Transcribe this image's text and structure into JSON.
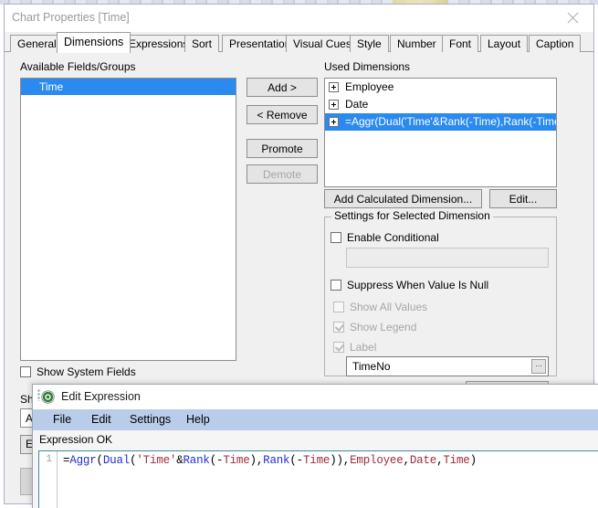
{
  "chart_properties": {
    "title": "Chart Properties [Time]",
    "close_icon": "close-icon",
    "tabs": [
      {
        "label": "General",
        "active": false
      },
      {
        "label": "Dimensions",
        "active": true
      },
      {
        "label": "Expressions",
        "active": false
      },
      {
        "label": "Sort",
        "active": false
      },
      {
        "label": "Presentation",
        "active": false
      },
      {
        "label": "Visual Cues",
        "active": false
      },
      {
        "label": "Style",
        "active": false
      },
      {
        "label": "Number",
        "active": false
      },
      {
        "label": "Font",
        "active": false
      },
      {
        "label": "Layout",
        "active": false
      },
      {
        "label": "Caption",
        "active": false
      }
    ],
    "available": {
      "label": "Available Fields/Groups",
      "items": [
        {
          "label": "Time",
          "selected": true
        }
      ]
    },
    "transfer_buttons": [
      {
        "label": "Add >",
        "enabled": true
      },
      {
        "label": "< Remove",
        "enabled": true
      },
      {
        "label": "Promote",
        "enabled": true
      },
      {
        "label": "Demote",
        "enabled": false
      }
    ],
    "used": {
      "label": "Used Dimensions",
      "items": [
        {
          "label": "Employee",
          "selected": false
        },
        {
          "label": "Date",
          "selected": false
        },
        {
          "label": "=Aggr(Dual('Time'&Rank(-Time),Rank(-Time)),Empl",
          "selected": true
        }
      ]
    },
    "add_calculated_label": "Add Calculated Dimension...",
    "edit_label": "Edit...",
    "settings": {
      "legend": "Settings for Selected Dimension",
      "enable_conditional": {
        "label": "Enable Conditional",
        "checked": false,
        "enabled": true
      },
      "conditional_value": "",
      "suppress_when_null": {
        "label": "Suppress When Value Is Null",
        "checked": false,
        "enabled": true
      },
      "show_all_values": {
        "label": "Show All Values",
        "checked": false,
        "enabled": false
      },
      "show_legend": {
        "label": "Show Legend",
        "checked": true,
        "enabled": false
      },
      "label_checkbox": {
        "label": "Label",
        "checked": true,
        "enabled": false
      },
      "label_value": "TimeNo",
      "label_ellipsis": "..."
    },
    "show_system_fields": {
      "label": "Show System Fields",
      "checked": false
    },
    "show_label_truncated": "Sho",
    "combo_all_value": "All",
    "edit_button_truncated": "E"
  },
  "edit_expression": {
    "title": "Edit Expression",
    "app_icon": "qlikview-icon",
    "menus": [
      "File",
      "Edit",
      "Settings",
      "Help"
    ],
    "status": "Expression OK",
    "line_number": "1",
    "expression": "=Aggr(Dual('Time'&Rank(-Time),Rank(-Time)),Employee,Date,Time)",
    "tokens": [
      {
        "t": "=",
        "c": "pun"
      },
      {
        "t": "Aggr",
        "c": "fn"
      },
      {
        "t": "(",
        "c": "pun"
      },
      {
        "t": "Dual",
        "c": "fn"
      },
      {
        "t": "(",
        "c": "pun"
      },
      {
        "t": "'Time'",
        "c": "str"
      },
      {
        "t": "&",
        "c": "pun"
      },
      {
        "t": "Rank",
        "c": "fn"
      },
      {
        "t": "(-",
        "c": "pun"
      },
      {
        "t": "Time",
        "c": "fld"
      },
      {
        "t": "),",
        "c": "pun"
      },
      {
        "t": "Rank",
        "c": "fn"
      },
      {
        "t": "(-",
        "c": "pun"
      },
      {
        "t": "Time",
        "c": "fld"
      },
      {
        "t": ")),",
        "c": "pun"
      },
      {
        "t": "Employee",
        "c": "fld"
      },
      {
        "t": ",",
        "c": "pun"
      },
      {
        "t": "Date",
        "c": "fld"
      },
      {
        "t": ",",
        "c": "pun"
      },
      {
        "t": "Time",
        "c": "fld"
      },
      {
        "t": ")",
        "c": "pun"
      }
    ]
  },
  "colors": {
    "selection_blue": "#2a8aef",
    "menubar_blue": "#b9cdea",
    "editor_border": "#3f8c9b",
    "function_token": "#2030d0",
    "field_token": "#9c2b3c",
    "disabled_text": "#a6a6a6"
  }
}
